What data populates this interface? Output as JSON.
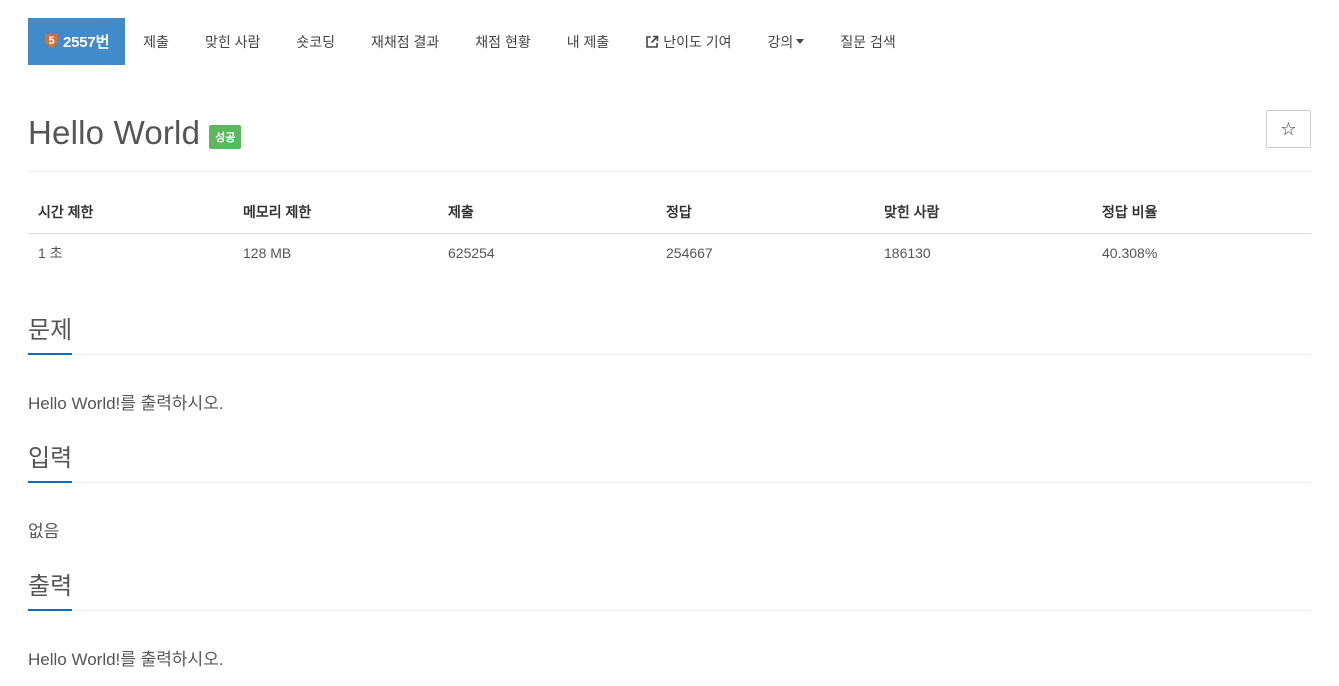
{
  "nav": {
    "tier_level": "5",
    "tier_color": "#c67739",
    "problem_number": "2557번",
    "items": [
      {
        "label": "제출"
      },
      {
        "label": "맞힌 사람"
      },
      {
        "label": "숏코딩"
      },
      {
        "label": "재채점 결과"
      },
      {
        "label": "채점 현황"
      },
      {
        "label": "내 제출"
      },
      {
        "label": "난이도 기여",
        "icon": "external-link-icon"
      },
      {
        "label": "강의",
        "icon": "caret-down-icon"
      },
      {
        "label": "질문 검색"
      }
    ],
    "active_color": "#428bca"
  },
  "problem": {
    "title": "Hello World",
    "status_badge": "성공",
    "status_color": "#5cb85c",
    "star_icon": "star-outline-icon"
  },
  "info_table": {
    "headers": [
      "시간 제한",
      "메모리 제한",
      "제출",
      "정답",
      "맞힌 사람",
      "정답 비율"
    ],
    "row": [
      "1 초",
      "128 MB",
      "625254",
      "254667",
      "186130",
      "40.308%"
    ]
  },
  "sections": {
    "description": {
      "heading": "문제",
      "text": "Hello World!를 출력하시오."
    },
    "input": {
      "heading": "입력",
      "text": "없음"
    },
    "output": {
      "heading": "출력",
      "text": "Hello World!를 출력하시오."
    }
  }
}
